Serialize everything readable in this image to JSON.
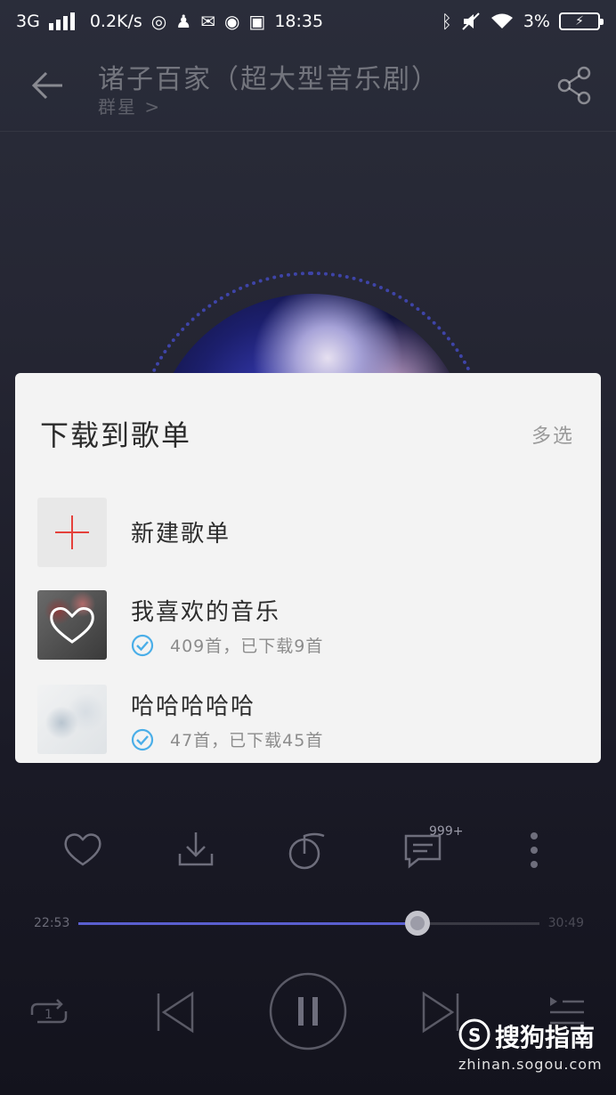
{
  "status_bar": {
    "network": "3G",
    "speed": "0.2K/s",
    "time": "18:35",
    "battery": "3%"
  },
  "header": {
    "title": "诸子百家（超大型音乐剧）",
    "artist": "群星 >"
  },
  "dialog": {
    "title": "下载到歌单",
    "multi_select": "多选",
    "new_playlist_label": "新建歌单",
    "playlists": [
      {
        "name": "我喜欢的音乐",
        "info": "409首，已下载9首"
      },
      {
        "name": "哈哈哈哈哈",
        "info": "47首，已下载45首"
      }
    ]
  },
  "actions": {
    "comment_count": "999+"
  },
  "player": {
    "current_time": "22:53",
    "total_time": "30:49",
    "progress": 0.736
  },
  "watermark": {
    "brand": "搜狗指南",
    "url": "zhinan.sogou.com"
  },
  "colors": {
    "accent_red": "#e5413b",
    "check_blue": "#4aaee8",
    "progress_blue": "#5a5fd0"
  }
}
